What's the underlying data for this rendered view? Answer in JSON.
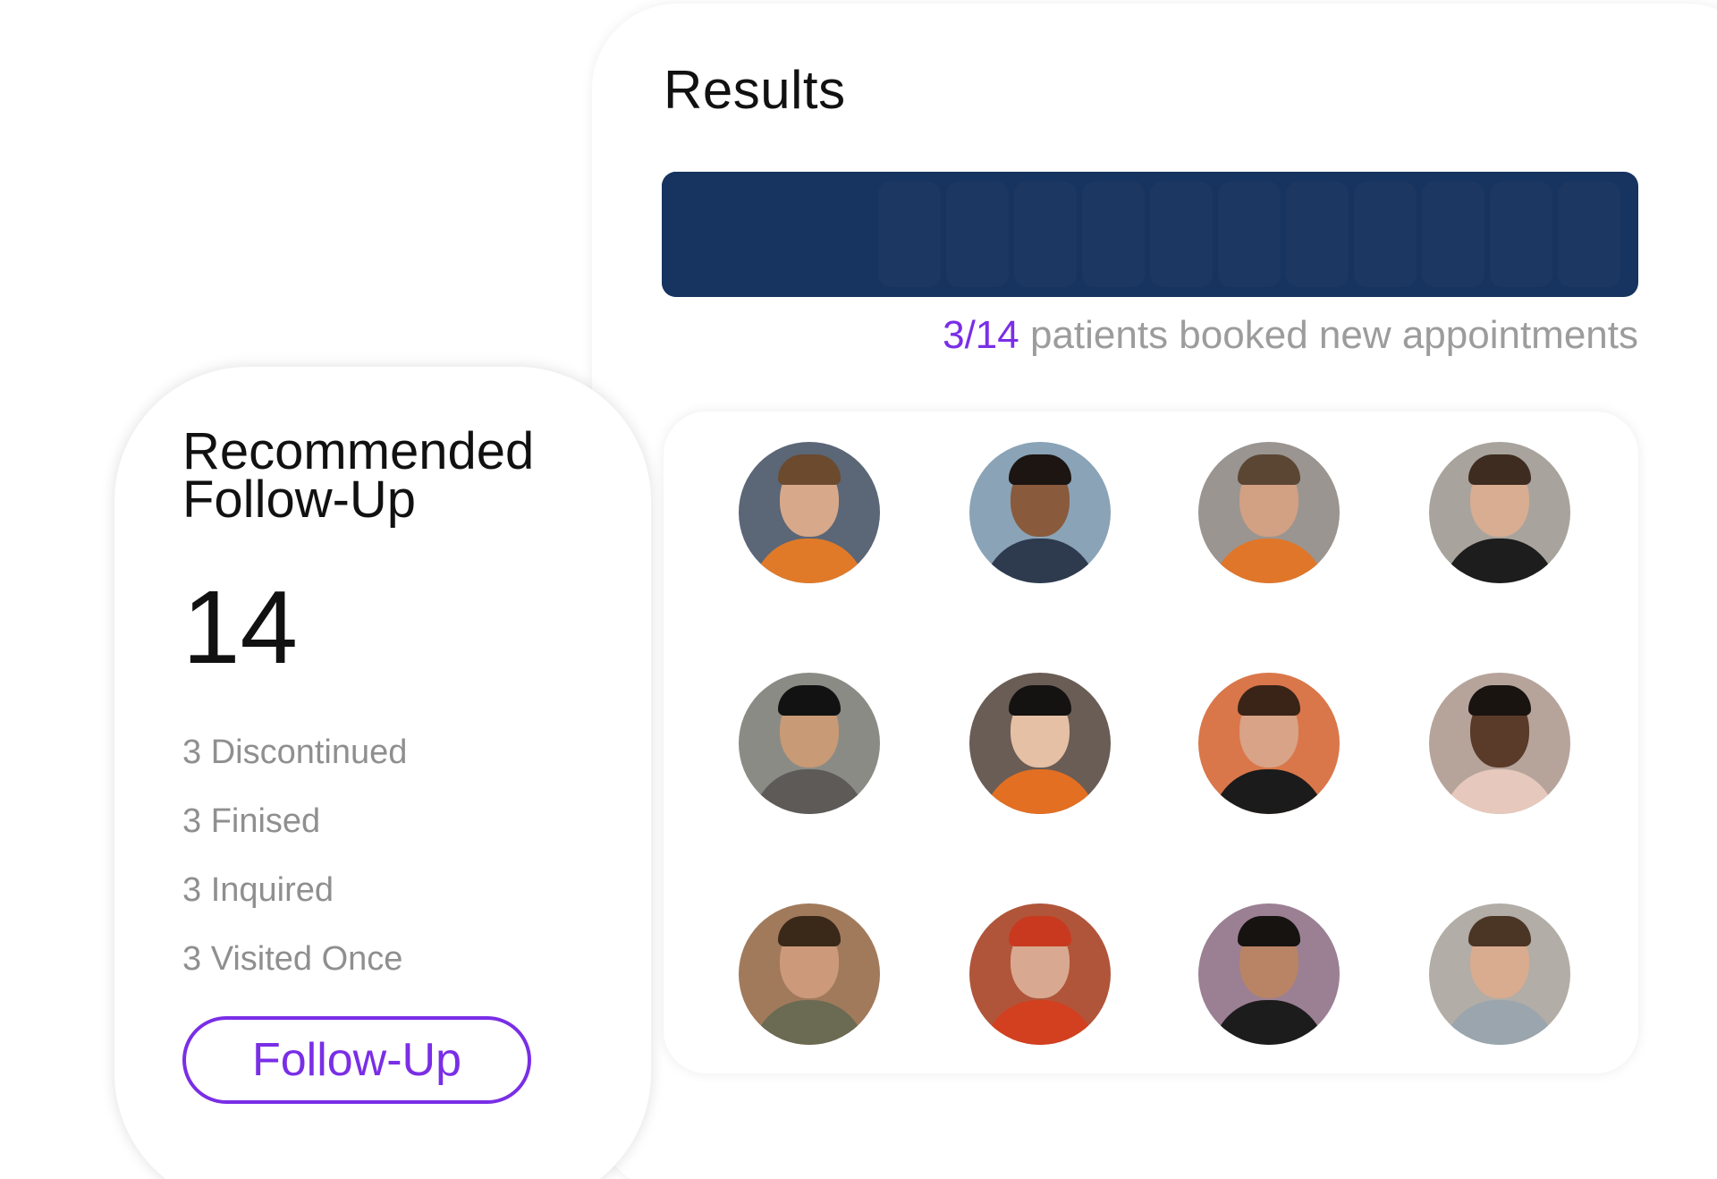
{
  "results": {
    "title": "Results",
    "bar_color": "#17335f",
    "booked_count": "3/14",
    "booked_label": " patients booked new appointments",
    "accent_color": "#7a2ee6",
    "patients": [
      {
        "icon": "patient-photo",
        "bg": "#5b6677",
        "skin": "#d7a98a",
        "hair": "#6b4a2e",
        "shirt": "#e07a28"
      },
      {
        "icon": "patient-photo",
        "bg": "#8aa3b6",
        "skin": "#8a5a3c",
        "hair": "#1c1512",
        "shirt": "#2e3a4e"
      },
      {
        "icon": "patient-photo",
        "bg": "#9a9590",
        "skin": "#d2a083",
        "hair": "#5b4634",
        "shirt": "#e0762a"
      },
      {
        "icon": "patient-photo",
        "bg": "#a8a39d",
        "skin": "#d9ad92",
        "hair": "#3e2c20",
        "shirt": "#1d1d1d"
      },
      {
        "icon": "patient-photo",
        "bg": "#8b8b86",
        "skin": "#c99a76",
        "hair": "#121212",
        "shirt": "#5d5a58"
      },
      {
        "icon": "patient-photo",
        "bg": "#6a5d55",
        "skin": "#e6c0a4",
        "hair": "#151212",
        "shirt": "#e36f22"
      },
      {
        "icon": "patient-photo",
        "bg": "#d9774a",
        "skin": "#d8a387",
        "hair": "#3a2418",
        "shirt": "#1b1b1b"
      },
      {
        "icon": "patient-photo",
        "bg": "#b6a49b",
        "skin": "#5a3a28",
        "hair": "#1a1411",
        "shirt": "#e6c9bc"
      },
      {
        "icon": "patient-photo",
        "bg": "#a17a5c",
        "skin": "#cc9a7b",
        "hair": "#3a2819",
        "shirt": "#6b6a52"
      },
      {
        "icon": "patient-photo",
        "bg": "#b0553a",
        "skin": "#d8a990",
        "hair": "#c9391f",
        "shirt": "#d2401f"
      },
      {
        "icon": "patient-photo",
        "bg": "#9b7f93",
        "skin": "#b88465",
        "hair": "#161311",
        "shirt": "#1d1c1c"
      },
      {
        "icon": "patient-photo",
        "bg": "#b2ada6",
        "skin": "#d9ab8f",
        "hair": "#4b3524",
        "shirt": "#9aa5ad"
      }
    ]
  },
  "follow_up": {
    "title": "Recommended Follow-Up",
    "total": "14",
    "breakdown": [
      "3 Discontinued",
      "3 Finised",
      "3 Inquired",
      "3 Visited Once"
    ],
    "button_label": "Follow-Up"
  }
}
